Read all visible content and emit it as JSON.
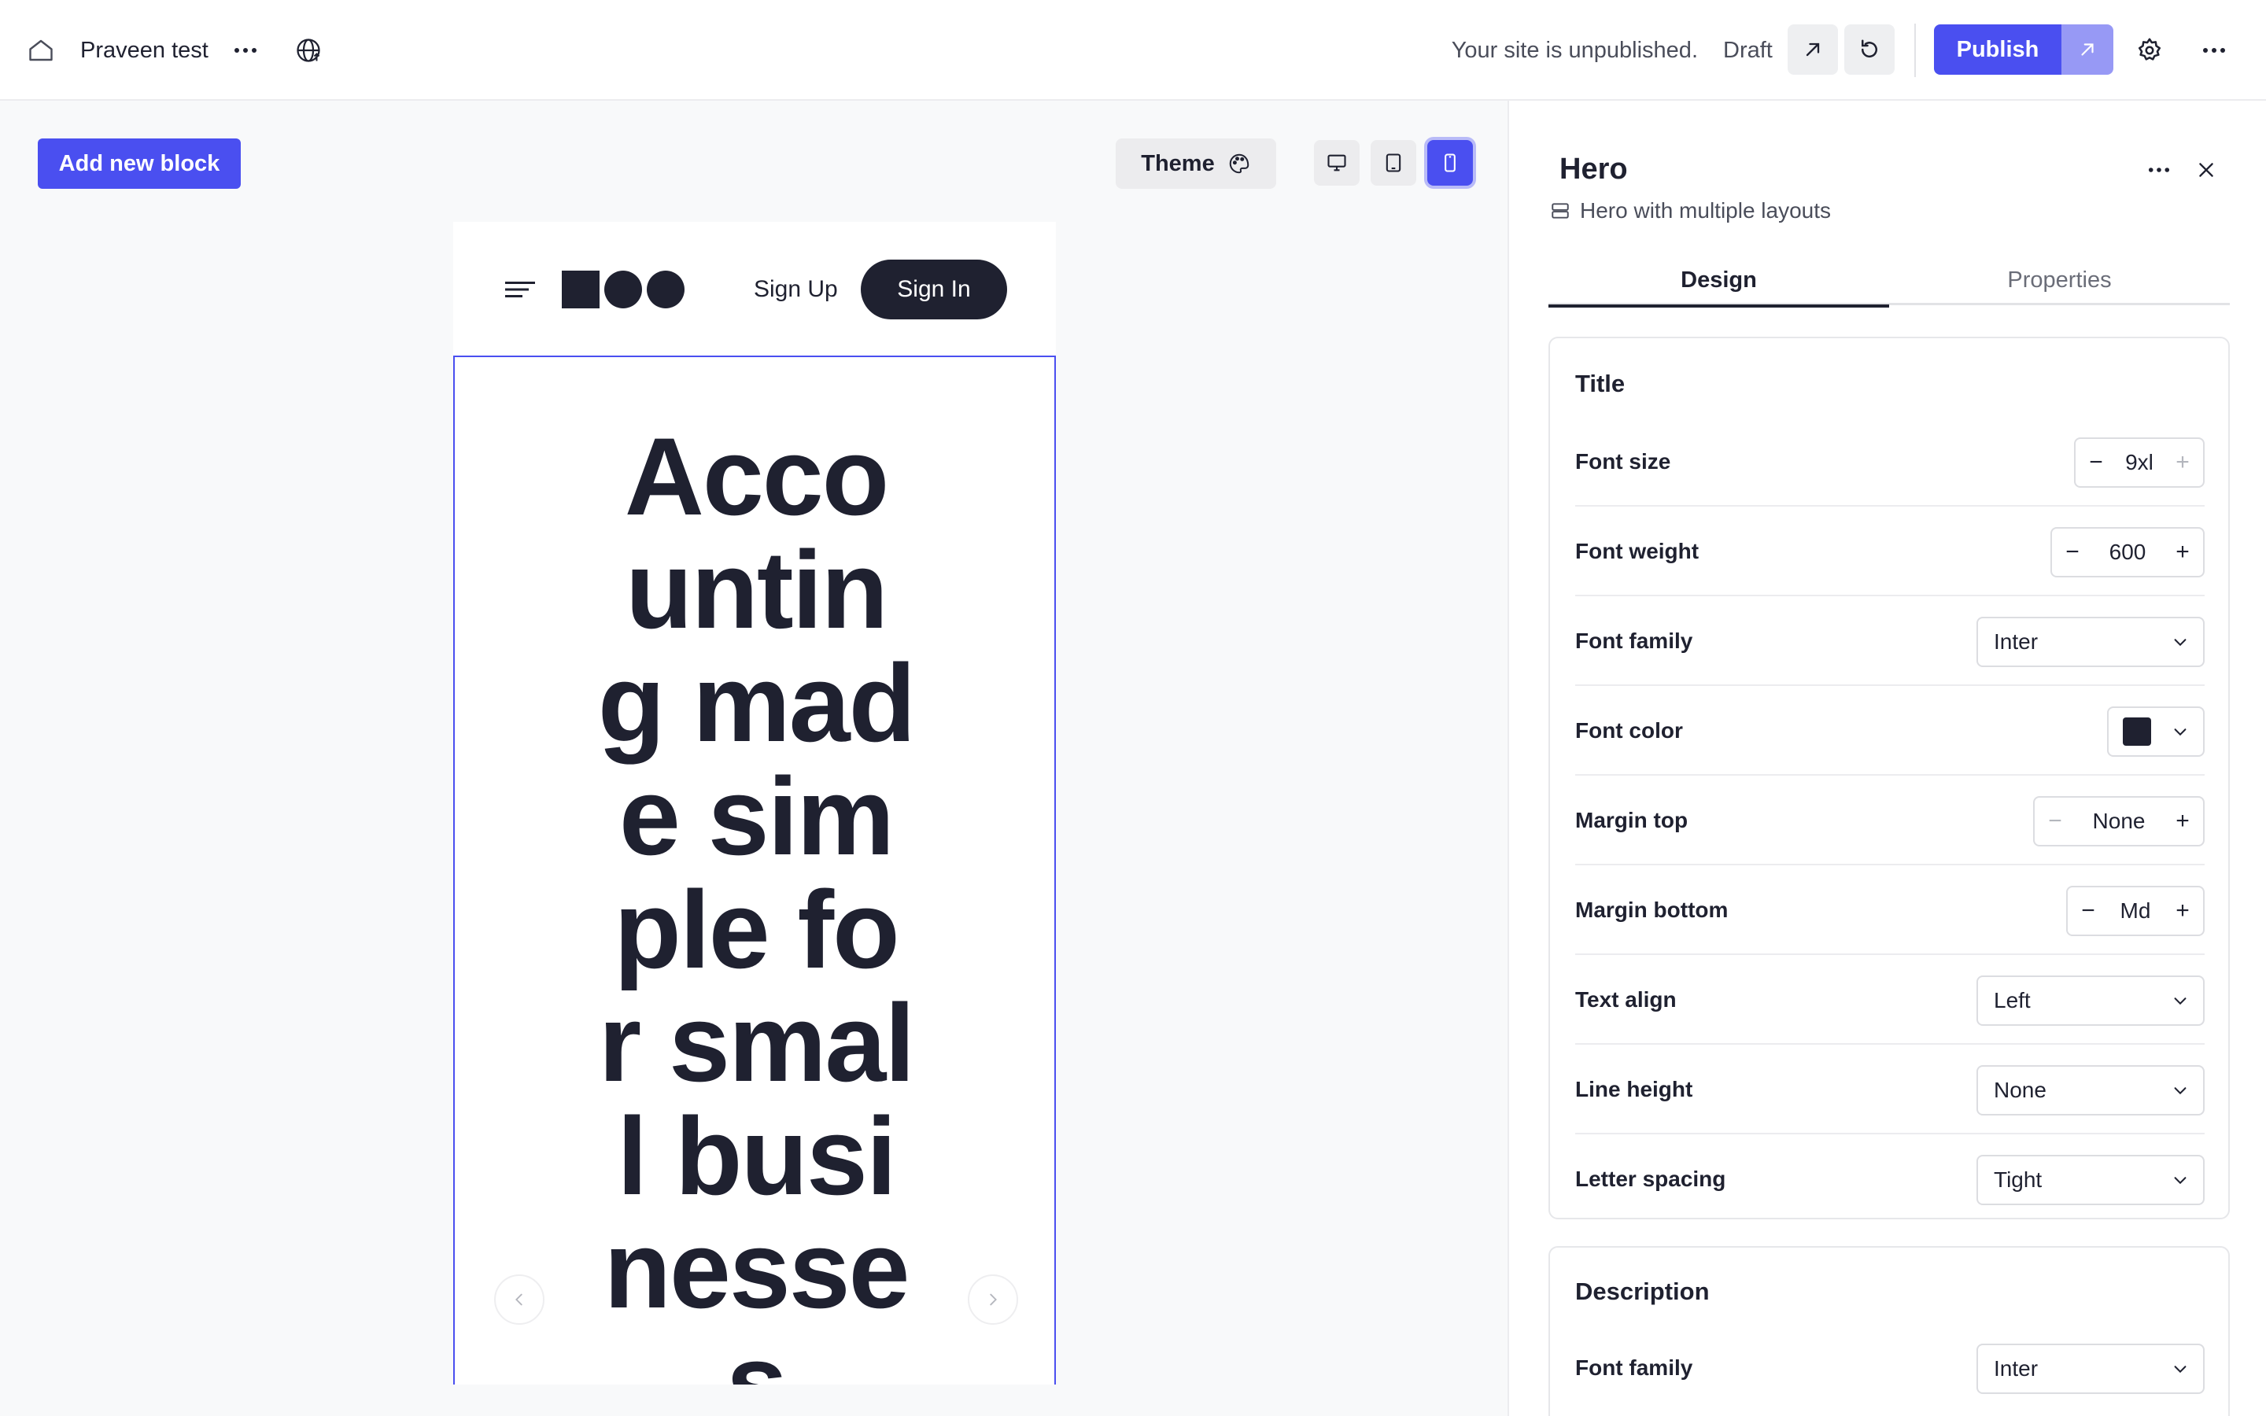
{
  "topbar": {
    "site_name": "Praveen test",
    "status_text": "Your site is unpublished.",
    "draft_label": "Draft",
    "publish_label": "Publish"
  },
  "canvas": {
    "add_block_label": "Add new block",
    "theme_label": "Theme",
    "preview": {
      "signup_label": "Sign Up",
      "signin_label": "Sign In",
      "hero_title": "Accounting made simple for small businesses"
    }
  },
  "panel": {
    "title": "Hero",
    "subtitle": "Hero with multiple layouts",
    "tabs": [
      "Design",
      "Properties"
    ],
    "title_section": {
      "heading": "Title",
      "font_size": {
        "label": "Font size",
        "value": "9xl"
      },
      "font_weight": {
        "label": "Font weight",
        "value": "600"
      },
      "font_family": {
        "label": "Font family",
        "value": "Inter"
      },
      "font_color": {
        "label": "Font color",
        "value": "#1f2130"
      },
      "margin_top": {
        "label": "Margin top",
        "value": "None"
      },
      "margin_bottom": {
        "label": "Margin bottom",
        "value": "Md"
      },
      "text_align": {
        "label": "Text align",
        "value": "Left"
      },
      "line_height": {
        "label": "Line height",
        "value": "None"
      },
      "letter_spacing": {
        "label": "Letter spacing",
        "value": "Tight"
      }
    },
    "description_section": {
      "heading": "Description",
      "font_family": {
        "label": "Font family",
        "value": "Inter"
      }
    }
  },
  "colors": {
    "accent": "#4a4ff0",
    "accent_light": "#9799f5",
    "dark": "#1f2130"
  }
}
